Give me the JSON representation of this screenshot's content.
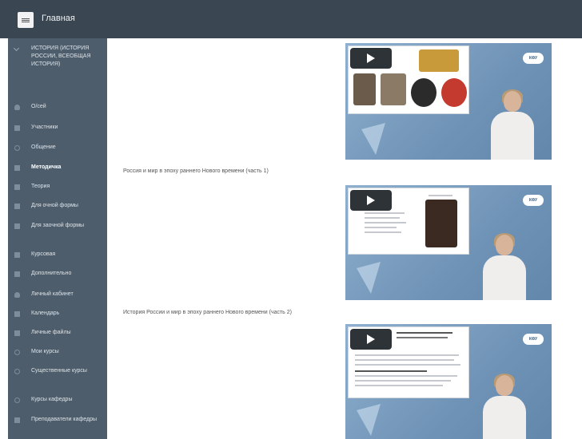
{
  "topbar": {
    "title": "Главная"
  },
  "sidebar": {
    "items": [
      {
        "label": "ИСТОРИЯ (ИСТОРИЯ РОССИИ, ВСЕОБЩАЯ ИСТОРИЯ)",
        "icon": "chevron-icon"
      },
      {
        "label": "О/сей",
        "icon": "user-icon"
      },
      {
        "label": "Участники",
        "icon": "users-icon"
      },
      {
        "label": "Общение",
        "icon": "chat-icon"
      },
      {
        "label": "Методичка",
        "icon": "book-icon"
      },
      {
        "label": "Теория",
        "icon": "document-icon"
      },
      {
        "label": "Для очной формы",
        "icon": "folder-icon"
      },
      {
        "label": "Для заочной формы",
        "icon": "folder-icon"
      },
      {
        "label": "Курсовая",
        "icon": "document-icon"
      },
      {
        "label": "Дополнительно",
        "icon": "folder-icon"
      },
      {
        "label": "Личный кабинет",
        "icon": "user-icon"
      },
      {
        "label": "Календарь",
        "icon": "calendar-icon"
      },
      {
        "label": "Личные файлы",
        "icon": "file-icon"
      },
      {
        "label": "Мои курсы",
        "icon": "course-icon"
      },
      {
        "label": "Существенные курсы",
        "icon": "course-icon"
      },
      {
        "label": "Курсы кафедры",
        "icon": "course-icon"
      },
      {
        "label": "Преподаватели кафедры",
        "icon": "users-icon"
      }
    ]
  },
  "videos": [
    {
      "caption": "",
      "badge": "КФУ"
    },
    {
      "caption": "Россия и мир в эпоху раннего Нового времени (часть 1)",
      "badge": "КФУ"
    },
    {
      "caption": "История России и мир в эпоху раннего Нового времени (часть 2)",
      "badge": "КФУ"
    }
  ],
  "colors": {
    "topbar": "#3a4651",
    "sidebar": "#4d5d6c",
    "video_bg": "#7c9ec0"
  }
}
